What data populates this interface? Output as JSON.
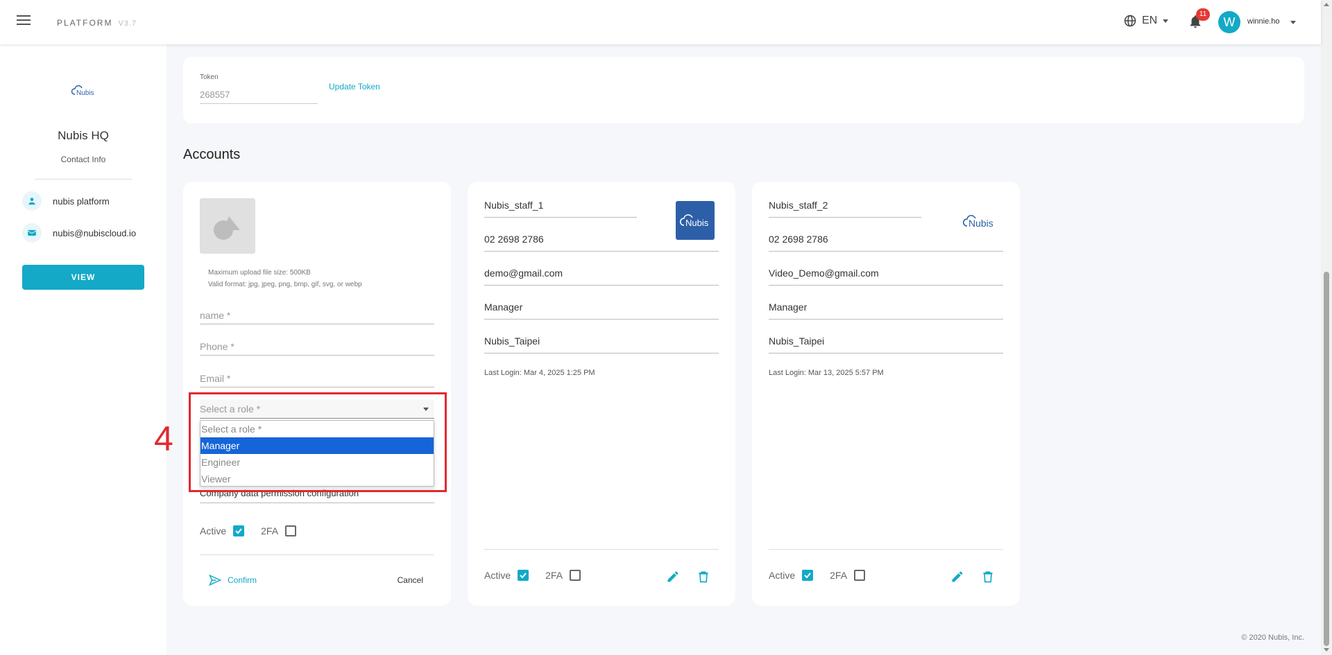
{
  "header": {
    "brand": "PLATFORM",
    "version": "V3.7",
    "language": "EN",
    "notification_count": "11",
    "avatar_letter": "W",
    "username": "winnie.ho"
  },
  "sidebar": {
    "company_name": "Nubis HQ",
    "contact_title": "Contact Info",
    "contact_name": "nubis platform",
    "contact_email": "nubis@nubiscloud.io",
    "view_label": "VIEW"
  },
  "token": {
    "label": "Token",
    "value": "268557",
    "update_label": "Update Token"
  },
  "accounts": {
    "title": "Accounts",
    "new_form": {
      "upload_hint_size": "Maximum upload file size: 500KB",
      "upload_hint_format": "Valid format: jpg, jpeg, png, bmp, gif, svg, or webp",
      "name_placeholder": "name *",
      "phone_placeholder": "Phone *",
      "email_placeholder": "Email *",
      "role_placeholder": "Select a role *",
      "role_options": [
        "Select a role *",
        "Manager",
        "Engineer",
        "Viewer"
      ],
      "selected_option": "Manager",
      "company_permission": "Company data permission configuration",
      "active_label": "Active",
      "twofa_label": "2FA",
      "confirm_label": "Confirm",
      "cancel_label": "Cancel"
    },
    "list": [
      {
        "name": "Nubis_staff_1",
        "phone": "02 2698 2786",
        "email": "demo@gmail.com",
        "role": "Manager",
        "location": "Nubis_Taipei",
        "last_login": "Last Login: Mar 4, 2025 1:25 PM",
        "active_label": "Active",
        "twofa_label": "2FA"
      },
      {
        "name": "Nubis_staff_2",
        "phone": "02 2698 2786",
        "email": "Video_Demo@gmail.com",
        "role": "Manager",
        "location": "Nubis_Taipei",
        "last_login": "Last Login: Mar 13, 2025 5:57 PM",
        "active_label": "Active",
        "twofa_label": "2FA"
      }
    ]
  },
  "logo_text": "Nubis",
  "annotation_number": "4",
  "footer": "© 2020 Nubis, Inc.",
  "colors": {
    "accent": "#13a9c7",
    "badge": "#e53935",
    "annotation": "#e3282e",
    "selected_option": "#1565d8"
  }
}
